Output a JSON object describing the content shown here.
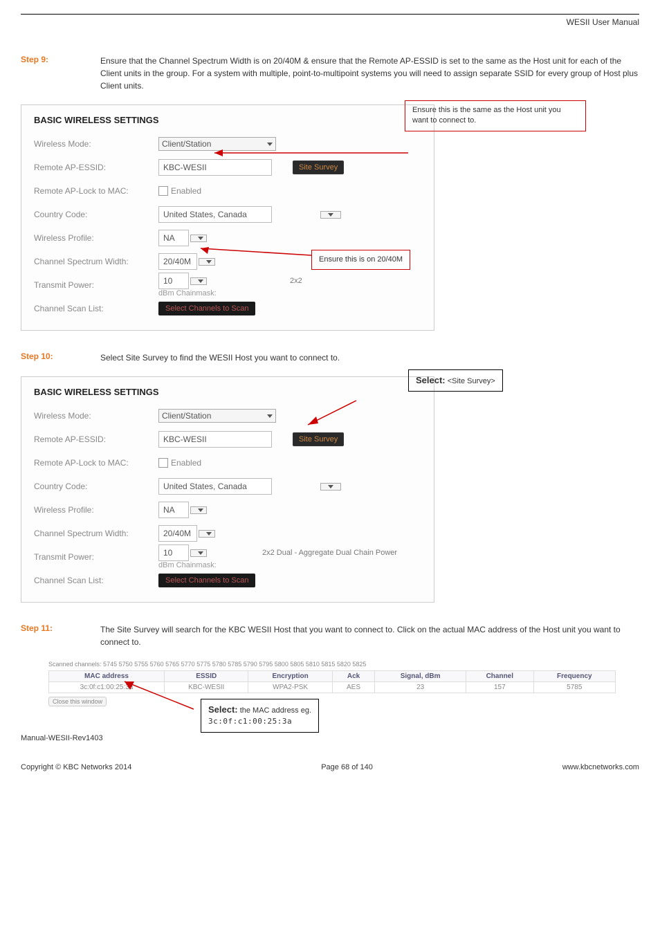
{
  "header": {
    "title": "WESII User Manual"
  },
  "step9": {
    "label": "Step 9:",
    "text": "Ensure that the Channel Spectrum Width is on 20/40M & ensure that the Remote AP-ESSID is set to the same as the Host unit for each of the Client units in the group. For a system with multiple, point-to-multipoint systems you will need to assign separate SSID for every group of Host plus Client units."
  },
  "panel_title": "BASIC WIRELESS SETTINGS",
  "labels": {
    "wireless_mode": "Wireless Mode:",
    "remote_ap_essid": "Remote AP-ESSID:",
    "remote_ap_lock": "Remote AP-Lock to MAC:",
    "country_code": "Country Code:",
    "wireless_profile": "Wireless Profile:",
    "channel_spectrum": "Channel Spectrum Width:",
    "transmit_power": "Transmit Power:",
    "channel_scan": "Channel Scan List:"
  },
  "values": {
    "wireless_mode": "Client/Station",
    "essid": "KBC-WESII",
    "enabled": "Enabled",
    "country": "United States, Canada",
    "profile": "NA",
    "width": "20/40M",
    "power": "10",
    "dbm": "dBm Chainmask:",
    "chain": "2x2 Dual - Aggregate Dual Chain Power",
    "chain_partial": "2x2",
    "site_survey": "Site Survey",
    "scan_btn": "Select Channels to Scan"
  },
  "callouts": {
    "c1": "Ensure this is the same as the Host unit you want to connect to.",
    "c2": "Ensure this is on 20/40M",
    "c3_label": "Select:",
    "c3_val": "<Site Survey>",
    "c4_label": "Select:",
    "c4_text": "the MAC address eg.",
    "c4_mac": "3c:0f:c1:00:25:3a"
  },
  "step10": {
    "label": "Step 10:",
    "text": "Select Site Survey to find the WESII Host you want to connect to."
  },
  "step11": {
    "label": "Step 11:",
    "text": "The Site Survey will search for the KBC WESII Host that you want to connect to. Click on the actual MAC address of the Host unit you want to connect to."
  },
  "survey": {
    "scanned": "Scanned channels: 5745 5750 5755 5760 5765 5770 5775 5780 5785 5790 5795 5800 5805 5810 5815 5820 5825",
    "close": "Close this window",
    "headers": [
      "MAC address",
      "ESSID",
      "Encryption",
      "Ack",
      "Signal, dBm",
      "Channel",
      "Frequency"
    ],
    "row": [
      "3c:0f:c1:00:25:3a",
      "KBC-WESII",
      "WPA2-PSK",
      "AES",
      "23",
      "157",
      "5785"
    ]
  },
  "footer": {
    "left1": "Manual-WESII-Rev1403",
    "left2": "Copyright © KBC Networks 2014",
    "center": "Page 68 of 140",
    "right": "www.kbcnetworks.com"
  }
}
